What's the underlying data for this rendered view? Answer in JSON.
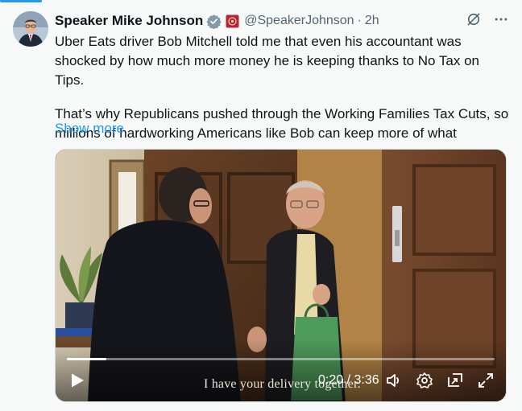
{
  "post": {
    "author_name": "Speaker Mike Johnson",
    "handle": "@SpeakerJohnson",
    "separator": "·",
    "time": "2h",
    "text_paragraphs": [
      "Uber Eats driver Bob Mitchell told me that even his accountant was shocked by how much more money he is keeping thanks to No Tax on Tips.",
      "That’s why Republicans pushed through the Working Families Tax Cuts, so millions of hardworking Americans like Bob can keep more of what"
    ],
    "show_more_label": "Show more"
  },
  "icons": {
    "verified": "verified-badge-icon",
    "affiliation": "house-seal-affiliation-icon",
    "grok": "grok-icon",
    "more": "more-options-icon",
    "play": "play-icon",
    "volume": "volume-icon",
    "settings": "settings-icon",
    "pip": "picture-in-picture-icon",
    "fullscreen": "fullscreen-icon"
  },
  "video": {
    "caption": "I have your delivery together.",
    "current_time": "0:20",
    "duration": "3:36",
    "time_readout": "0:20 / 3:36",
    "progress_fraction": 0.0926
  },
  "colors": {
    "accent": "#1d9bf0",
    "text_primary": "#0f1419",
    "text_secondary": "#536471",
    "background": "#f7f9f9"
  }
}
